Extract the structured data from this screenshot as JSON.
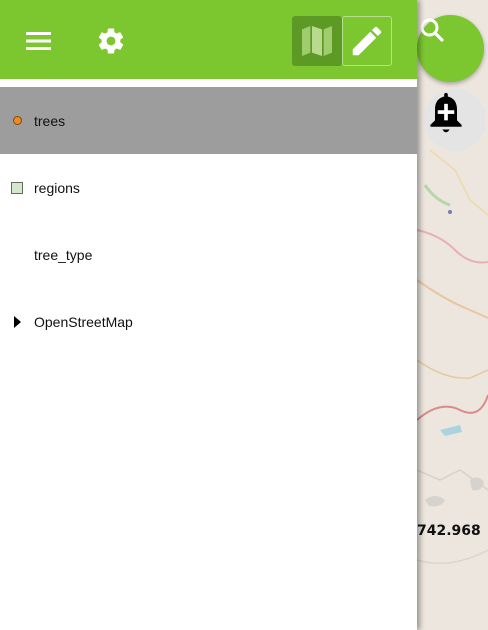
{
  "map": {
    "coordinate_readout": "742.968",
    "search_icon": "search-icon",
    "add_alert_icon": "bell-plus-icon"
  },
  "toolbar": {
    "menu_icon": "menu-icon",
    "settings_icon": "gear-icon",
    "map_icon": "map-icon",
    "edit_icon": "pencil-icon",
    "accent": "#7cc630"
  },
  "layers": [
    {
      "label": "trees",
      "marker": "orange-dot",
      "selected": true
    },
    {
      "label": "regions",
      "marker": "green-square",
      "selected": false
    },
    {
      "label": "tree_type",
      "marker": "none",
      "selected": false
    },
    {
      "label": "OpenStreetMap",
      "marker": "expand-triangle",
      "selected": false
    }
  ]
}
